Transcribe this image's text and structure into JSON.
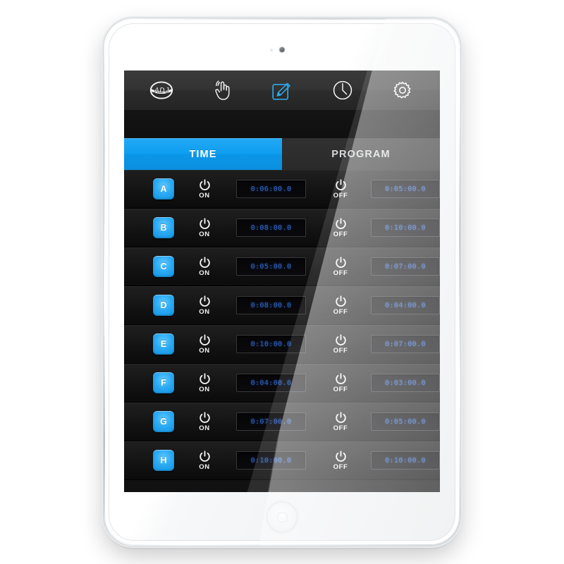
{
  "app": {
    "brand": "ADJ",
    "device": "tablet"
  },
  "toolbar": {
    "items": [
      {
        "name": "adj-logo-icon",
        "label": "ADJ",
        "active": false
      },
      {
        "name": "hand-touch-icon",
        "label": "Manual",
        "active": false
      },
      {
        "name": "pencil-edit-icon",
        "label": "Edit",
        "active": true
      },
      {
        "name": "clock-icon",
        "label": "Clock",
        "active": false
      },
      {
        "name": "gear-icon",
        "label": "Settings",
        "active": false
      }
    ]
  },
  "tabs": [
    {
      "label": "TIME",
      "active": true
    },
    {
      "label": "PROGRAM",
      "active": false
    }
  ],
  "labels": {
    "on": "ON",
    "off": "OFF"
  },
  "colors": {
    "accent": "#0e9ef0",
    "button_blue": "#2cabf4",
    "time_text": "#2f62c4",
    "screen_bg": "#0d0d0d",
    "toolbar_bg": "#333333"
  },
  "rows": [
    {
      "channel": "A",
      "on_time": "0:06:00.0",
      "off_time": "0:05:00.0"
    },
    {
      "channel": "B",
      "on_time": "0:08:00.0",
      "off_time": "0:10:00.0"
    },
    {
      "channel": "C",
      "on_time": "0:05:00.0",
      "off_time": "0:07:00.0"
    },
    {
      "channel": "D",
      "on_time": "0:08:00.0",
      "off_time": "0:04:00.0"
    },
    {
      "channel": "E",
      "on_time": "0:10:00.0",
      "off_time": "0:07:00.0"
    },
    {
      "channel": "F",
      "on_time": "0:04:00.0",
      "off_time": "0:03:00.0"
    },
    {
      "channel": "G",
      "on_time": "0:07:00.0",
      "off_time": "0:05:00.0"
    },
    {
      "channel": "H",
      "on_time": "0:10:00.0",
      "off_time": "0:10:00.0"
    }
  ]
}
